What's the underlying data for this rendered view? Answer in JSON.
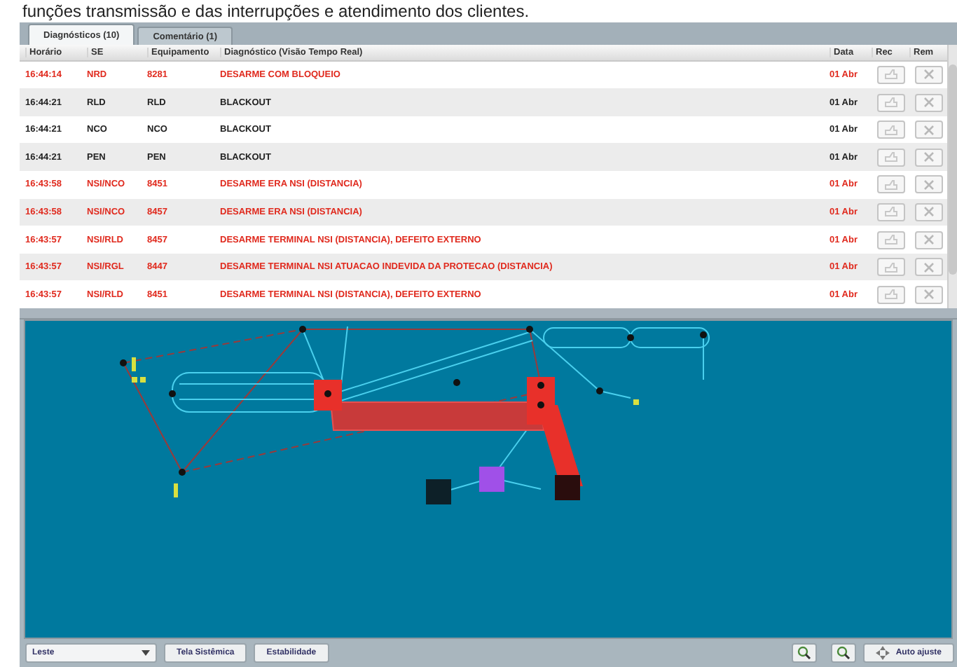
{
  "caption": "funções transmissão e das interrupções e atendimento dos clientes.",
  "tabs": [
    {
      "label": "Diagnósticos (10)",
      "selected": true
    },
    {
      "label": "Comentário (1)",
      "selected": false
    }
  ],
  "table": {
    "columns": [
      "Horário",
      "SE",
      "Equipamento",
      "Diagnóstico (Visão Tempo Real)",
      "Data",
      "Rec",
      "Rem"
    ],
    "rows": [
      {
        "time": "16:44:14",
        "se": "NRD",
        "equipment": "8281",
        "diagnosis": "DESARME COM BLOQUEIO",
        "date": "01 Abr",
        "alarm": true
      },
      {
        "time": "16:44:21",
        "se": "RLD",
        "equipment": "RLD",
        "diagnosis": "BLACKOUT",
        "date": "01 Abr",
        "alarm": false
      },
      {
        "time": "16:44:21",
        "se": "NCO",
        "equipment": "NCO",
        "diagnosis": "BLACKOUT",
        "date": "01 Abr",
        "alarm": false
      },
      {
        "time": "16:44:21",
        "se": "PEN",
        "equipment": "PEN",
        "diagnosis": "BLACKOUT",
        "date": "01 Abr",
        "alarm": false
      },
      {
        "time": "16:43:58",
        "se": "NSI/NCO",
        "equipment": "8451",
        "diagnosis": "DESARME ERA NSI (DISTANCIA)",
        "date": "01 Abr",
        "alarm": true
      },
      {
        "time": "16:43:58",
        "se": "NSI/NCO",
        "equipment": "8457",
        "diagnosis": "DESARME ERA NSI (DISTANCIA)",
        "date": "01 Abr",
        "alarm": true
      },
      {
        "time": "16:43:57",
        "se": "NSI/RLD",
        "equipment": "8457",
        "diagnosis": "DESARME TERMINAL NSI (DISTANCIA), DEFEITO EXTERNO",
        "date": "01 Abr",
        "alarm": true
      },
      {
        "time": "16:43:57",
        "se": "NSI/RGL",
        "equipment": "8447",
        "diagnosis": "DESARME TERMINAL NSI ATUACAO INDEVIDA DA PROTECAO (DISTANCIA)",
        "date": "01 Abr",
        "alarm": true
      },
      {
        "time": "16:43:57",
        "se": "NSI/RLD",
        "equipment": "8451",
        "diagnosis": "DESARME TERMINAL NSI (DISTANCIA), DEFEITO EXTERNO",
        "date": "01 Abr",
        "alarm": true
      }
    ]
  },
  "toolbar": {
    "region": "Leste",
    "buttons": [
      "Tela Sistêmica",
      "Estabilidade"
    ],
    "fit_button": "Auto ajuste"
  }
}
